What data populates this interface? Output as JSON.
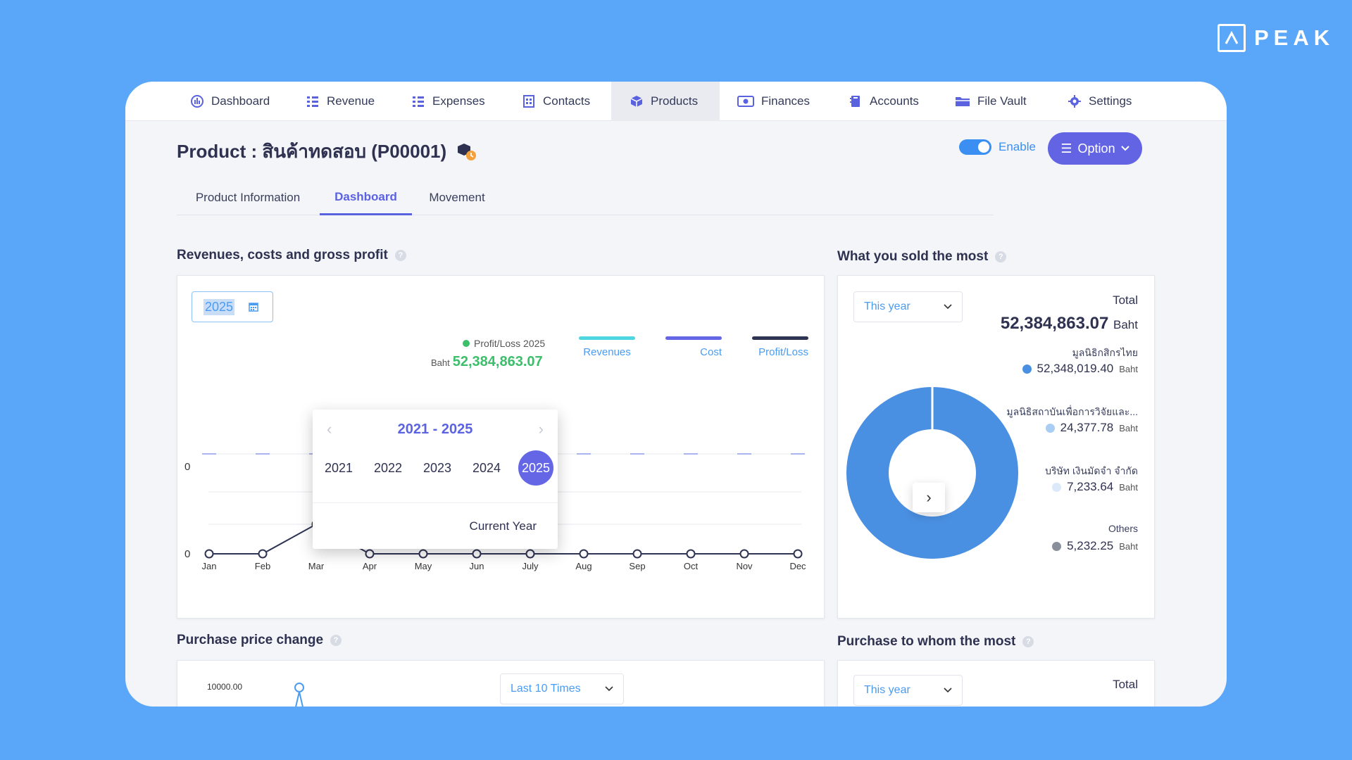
{
  "brand": {
    "name": "PEAK"
  },
  "nav": {
    "items": [
      {
        "label": "Dashboard",
        "icon": "dashboard-icon"
      },
      {
        "label": "Revenue",
        "icon": "revenue-list-icon"
      },
      {
        "label": "Expenses",
        "icon": "expenses-list-icon"
      },
      {
        "label": "Contacts",
        "icon": "contacts-icon"
      },
      {
        "label": "Products",
        "icon": "products-box-icon",
        "active": true
      },
      {
        "label": "Finances",
        "icon": "finances-money-icon"
      },
      {
        "label": "Accounts",
        "icon": "accounts-book-icon"
      },
      {
        "label": "File Vault",
        "icon": "folder-icon"
      },
      {
        "label": "Settings",
        "icon": "gear-icon"
      }
    ]
  },
  "header": {
    "title": "Product : สินค้าทดสอบ (P00001)",
    "enable_label": "Enable",
    "enabled": true,
    "option_label": "Option"
  },
  "tabs": [
    {
      "label": "Product Information"
    },
    {
      "label": "Dashboard",
      "active": true
    },
    {
      "label": "Movement"
    }
  ],
  "revenue_section": {
    "title": "Revenues, costs and gross profit",
    "year_value": "2025",
    "profit_label": "Profit/Loss 2025",
    "profit_unit": "Baht",
    "profit_value": "52,384,863.07",
    "legend": [
      "Revenues",
      "Cost",
      "Profit/Loss"
    ],
    "picker": {
      "range": "2021 - 2025",
      "years": [
        "2021",
        "2022",
        "2023",
        "2024",
        "2025"
      ],
      "selected": "2025",
      "footer": "Current Year"
    }
  },
  "chart_data": {
    "type": "line",
    "categories": [
      "Jan",
      "Feb",
      "Mar",
      "Apr",
      "May",
      "Jun",
      "July",
      "Aug",
      "Sep",
      "Oct",
      "Nov",
      "Dec"
    ],
    "series": [
      {
        "values": [
          0,
          0,
          1,
          0,
          0,
          0,
          0,
          0,
          0,
          0,
          0,
          0
        ]
      }
    ],
    "y_ticks": [
      "0",
      "0"
    ],
    "colors": {
      "revenues": "#4fd6e0",
      "cost": "#6466e6",
      "profit": "#2f3354"
    }
  },
  "sold_section": {
    "title": "What you sold the most",
    "period": "This year",
    "total_label": "Total",
    "total_value": "52,384,863.07",
    "unit": "Baht",
    "slices": [
      {
        "name": "มูลนิธิกสิกรไทย",
        "value": "52,348,019.40",
        "amount": 52348019.4,
        "color": "#4a90e2"
      },
      {
        "name": "มูลนิธิสถาบันเพื่อการวิจัยและ...",
        "value": "24,377.78",
        "amount": 24377.78,
        "color": "#a9cdf3"
      },
      {
        "name": "บริษัท เงินมัดจำ จำกัด",
        "value": "7,233.64",
        "amount": 7233.64,
        "color": "#dbe9fa"
      },
      {
        "name": "Others",
        "value": "5,232.25",
        "amount": 5232.25,
        "color": "#8a8f9c"
      }
    ]
  },
  "purchase_section": {
    "title": "Purchase price change",
    "period": "Last 10 Times",
    "y_tick": "10000.00"
  },
  "purchase_whom_section": {
    "title": "Purchase to whom the most",
    "period": "This year",
    "total_label": "Total"
  }
}
